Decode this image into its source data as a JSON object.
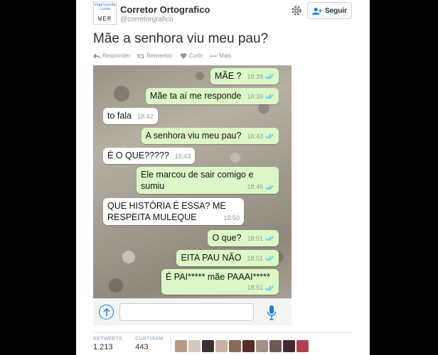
{
  "account": {
    "avatar_line1": "Vegalounda",
    "avatar_line2": "Linda",
    "avatar_keys": "WER",
    "name": "Corretor Ortografico",
    "handle": "@corretorgrafico",
    "follow_label": "Seguir"
  },
  "tweet": {
    "text": "Mãe a senhora viu meu pau?"
  },
  "actions": [
    {
      "label": "Responder",
      "icon": "reply-icon"
    },
    {
      "label": "Retweetar",
      "icon": "retweet-icon"
    },
    {
      "label": "Curtir",
      "icon": "heart-icon"
    },
    {
      "label": "Mais",
      "icon": "more-icon"
    }
  ],
  "chat": {
    "messages": [
      {
        "text": "MÃE ?",
        "time": "18:39",
        "dir": "out"
      },
      {
        "text": "Mãe ta aí me responde",
        "time": "18:39",
        "dir": "out"
      },
      {
        "text": "to fala",
        "time": "18:42",
        "dir": "in"
      },
      {
        "text": "A senhora viu meu pau?",
        "time": "18:43",
        "dir": "out"
      },
      {
        "text": "É O QUE?????",
        "time": "18:43",
        "dir": "in"
      },
      {
        "text": "Ele marcou de sair comigo e",
        "text2": "sumiu",
        "time": "18:46",
        "dir": "out"
      },
      {
        "text": "QUE HISTÓRIA É ESSA? ME",
        "text2": "RESPEITA MULEQUE",
        "time": "18:50",
        "dir": "in"
      },
      {
        "text": "O que?",
        "time": "18:51",
        "dir": "out"
      },
      {
        "text": "EITA PAU NÃO",
        "time": "18:51",
        "dir": "out"
      },
      {
        "text": "É PAI***** mãe PAAAI*****",
        "time": "18:51",
        "dir": "out"
      }
    ]
  },
  "stats": {
    "retweets_label": "RETWEETS",
    "retweets": "1.213",
    "likes_label": "CURTIRAM",
    "likes": "443"
  },
  "colors": {
    "outgoing_bubble": "#dcf8c6",
    "tick_color": "#4fc3f7",
    "link_blue": "#1e7fd6"
  }
}
